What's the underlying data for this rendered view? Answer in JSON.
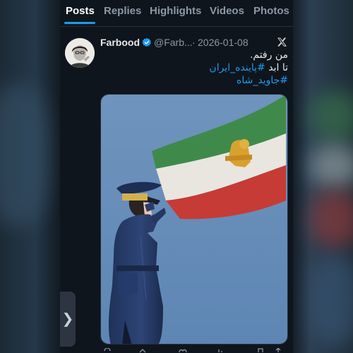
{
  "tabs": [
    {
      "label": "Posts",
      "active": true
    },
    {
      "label": "Replies",
      "active": false
    },
    {
      "label": "Highlights",
      "active": false
    },
    {
      "label": "Videos",
      "active": false
    },
    {
      "label": "Photos",
      "active": false
    }
  ],
  "post": {
    "author_name": "Farbood",
    "handle": "@Farb...",
    "separator": "·",
    "date": "2026-01-08",
    "verified": true,
    "text_line1": "من رفتم.",
    "text_line2_prefix": "تا ابد",
    "hashtag1": "#پاینده_ایران",
    "hashtag2": "#جاوید_شاه",
    "media_description_icon": "image-saluting-officer-with-flag"
  },
  "overlay": {
    "next_arrow": "❯"
  },
  "colors": {
    "accent": "#1d9bf0",
    "background": "#0f151d",
    "text": "#e7e9ea",
    "muted": "#8b98a5"
  }
}
